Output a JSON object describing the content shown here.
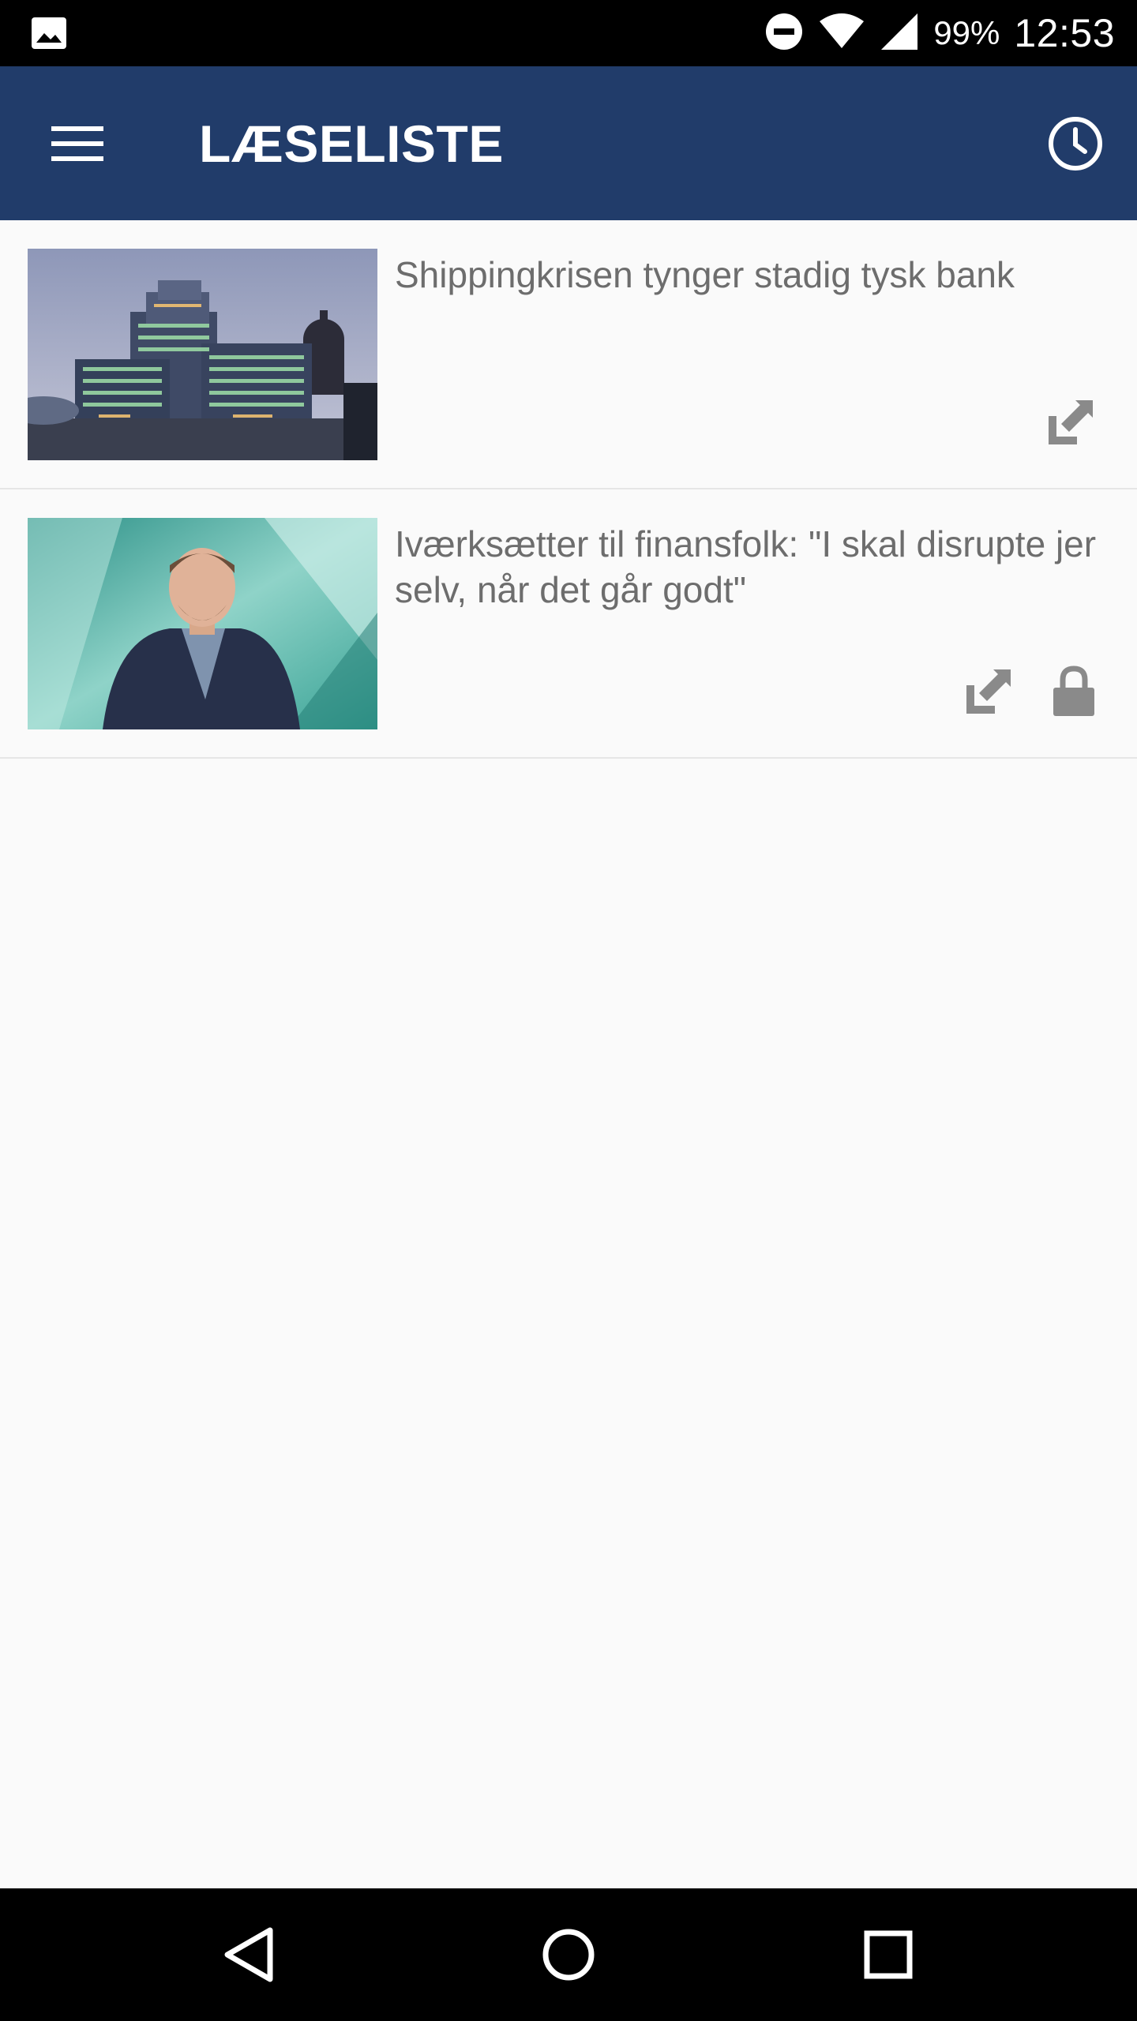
{
  "status_bar": {
    "notification_icon": "image-icon",
    "dnd_icon": "do-not-disturb-icon",
    "wifi_icon": "wifi-icon",
    "signal_icon": "cell-signal-icon",
    "battery": "99%",
    "time": "12:53"
  },
  "app_bar": {
    "menu_icon": "hamburger-menu-icon",
    "title": "LÆSELISTE",
    "history_icon": "clock-icon",
    "background": "#213c6a"
  },
  "articles": [
    {
      "title": "Shippingkrisen tynger stadig tysk bank",
      "image": "building-photo",
      "actions": [
        "share-out-icon"
      ],
      "locked": false
    },
    {
      "title": "Iværksætter til finansfolk: \"I skal disrupte jer selv, når det går godt\"",
      "image": "portrait-photo",
      "actions": [
        "share-out-icon",
        "lock-icon"
      ],
      "locked": true
    }
  ],
  "nav_bar": {
    "back_icon": "back-triangle-icon",
    "home_icon": "home-circle-icon",
    "recents_icon": "recents-square-icon"
  },
  "colors": {
    "accent": "#213c6a",
    "text": "#6d6d6d",
    "icon_grey": "#8a8a8a"
  }
}
